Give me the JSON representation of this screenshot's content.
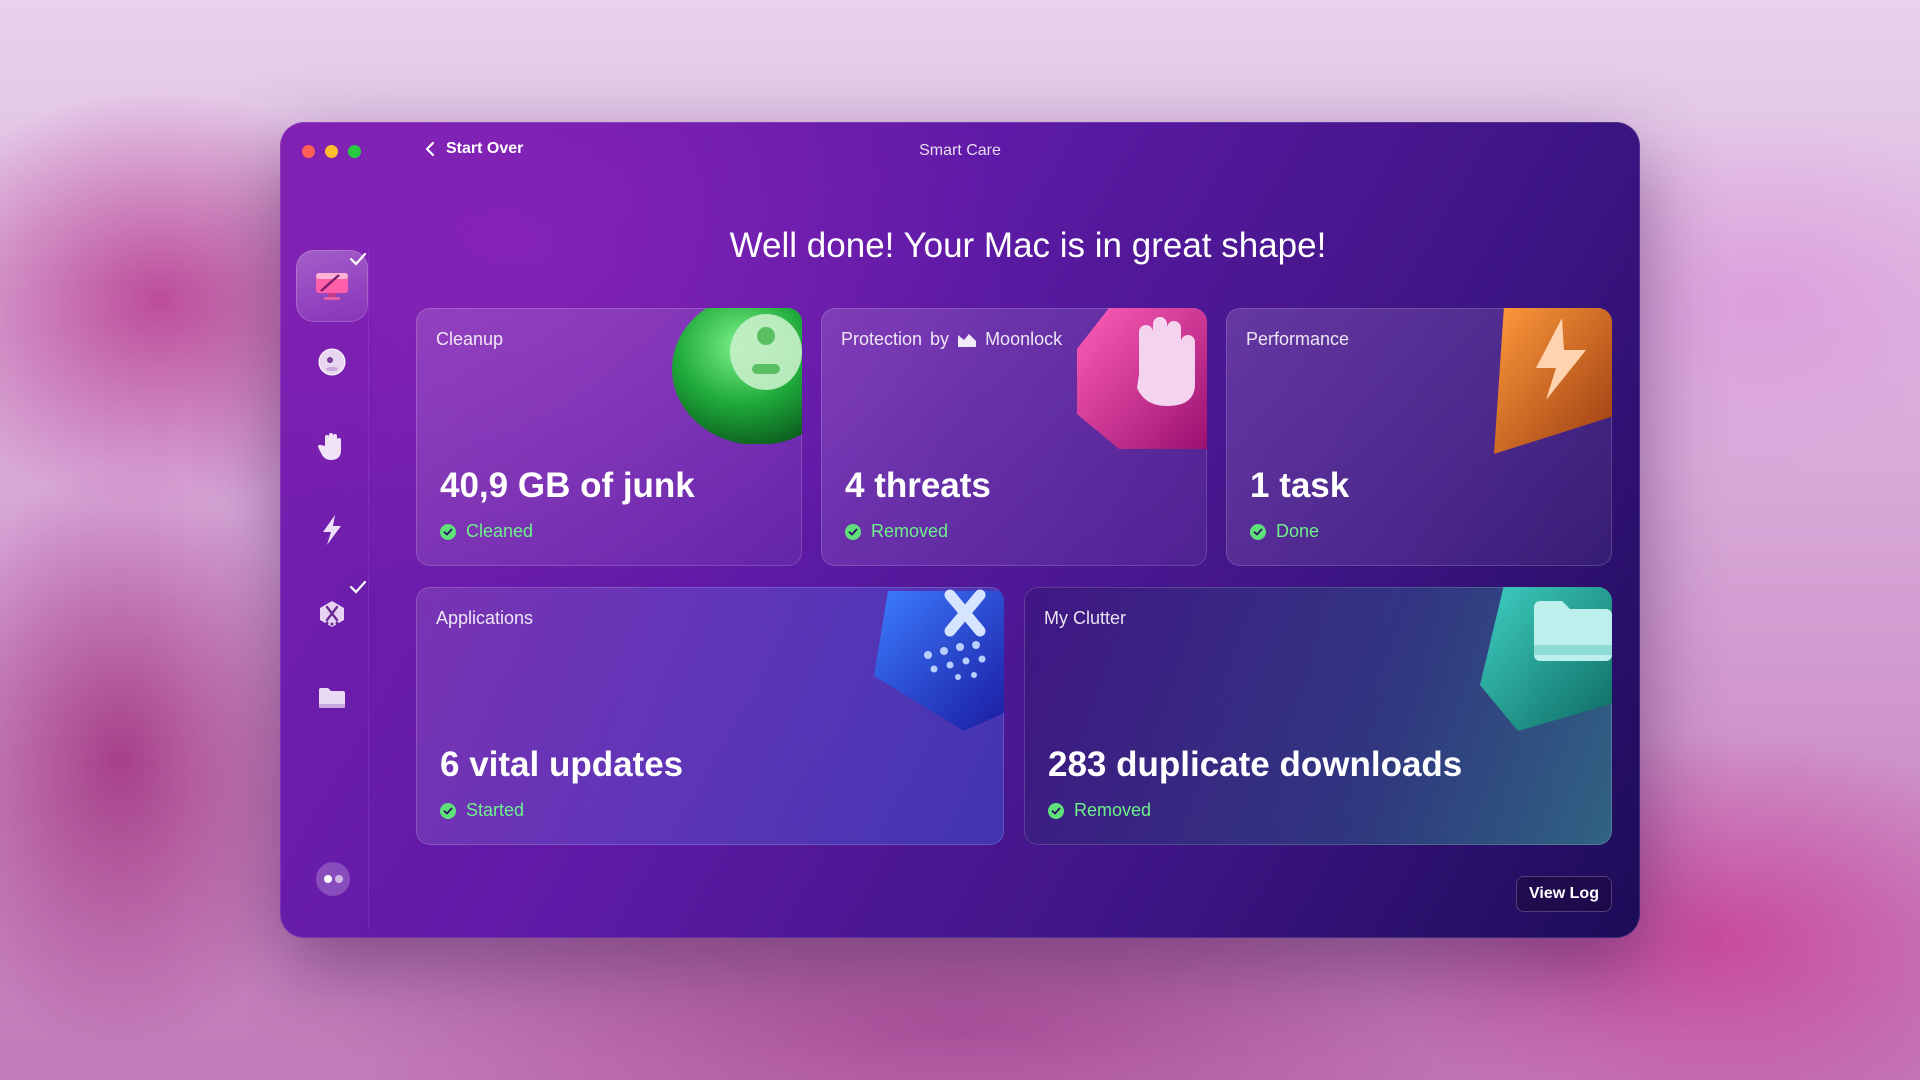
{
  "window": {
    "title": "Smart Care",
    "back_label": "Start Over",
    "headline": "Well done! Your Mac is in great shape!",
    "view_log_label": "View Log"
  },
  "sidebar": {
    "items": [
      {
        "name": "smart-care",
        "icon": "monitor-icon",
        "active": true,
        "checked": true
      },
      {
        "name": "cleanup",
        "icon": "bubble-icon",
        "active": false,
        "checked": false
      },
      {
        "name": "protection",
        "icon": "hand-icon",
        "active": false,
        "checked": false
      },
      {
        "name": "performance",
        "icon": "lightning-icon",
        "active": false,
        "checked": false
      },
      {
        "name": "applications",
        "icon": "apps-icon",
        "active": false,
        "checked": true
      },
      {
        "name": "my-clutter",
        "icon": "folder-icon",
        "active": false,
        "checked": false
      }
    ]
  },
  "cards": {
    "cleanup": {
      "label": "Cleanup",
      "value": "40,9 GB of junk",
      "status": "Cleaned"
    },
    "protection": {
      "label_prefix": "Protection",
      "label_by": "by",
      "brand": "Moonlock",
      "value": "4 threats",
      "status": "Removed"
    },
    "performance": {
      "label": "Performance",
      "value": "1 task",
      "status": "Done"
    },
    "applications": {
      "label": "Applications",
      "value": "6 vital updates",
      "status": "Started"
    },
    "clutter": {
      "label": "My Clutter",
      "value": "283 duplicate downloads",
      "status": "Removed"
    }
  },
  "colors": {
    "status_green": "#6ef08a",
    "window_accent": "#7a1fb0"
  }
}
